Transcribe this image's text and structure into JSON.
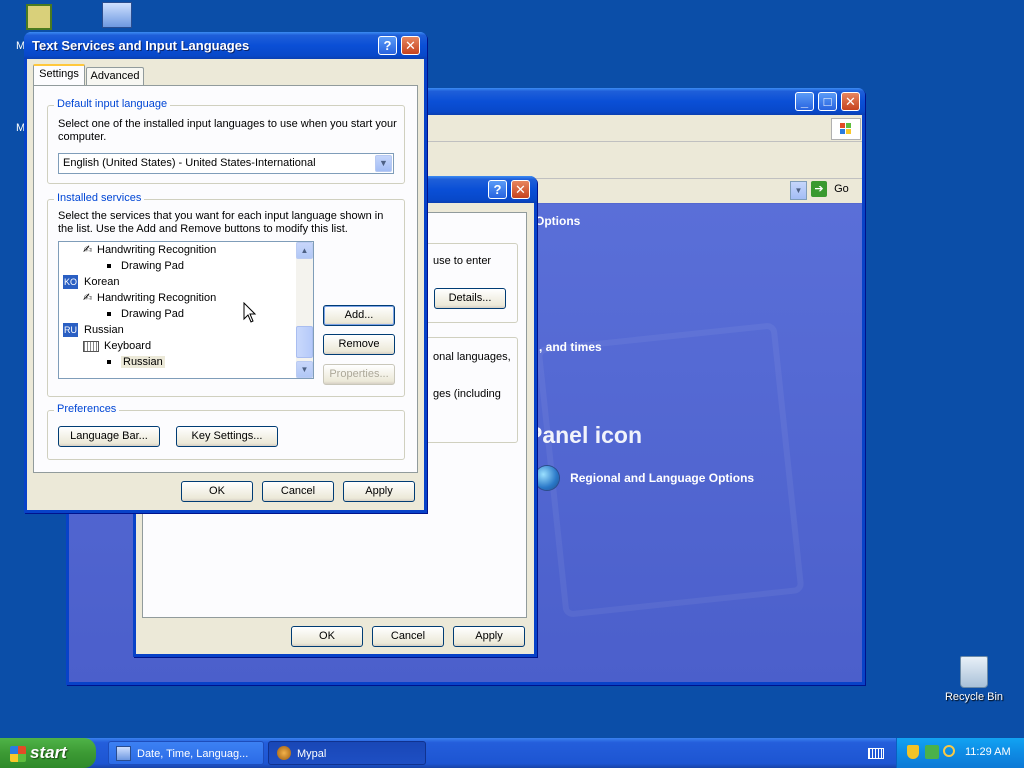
{
  "desktop": {
    "recycle_bin_label": "Recycle Bin",
    "left_icon_1_label": "M",
    "left_icon_2_label": "M"
  },
  "bg_window": {
    "address_go_label": "Go"
  },
  "cpanel": {
    "text_options": "Options",
    "text_and_times": ", and times",
    "text_panel_icon": "Panel icon",
    "link_regional": "Regional and Language Options"
  },
  "regional_dialog": {
    "text_use_to_enter": "use to enter",
    "details_button": "Details...",
    "text_onal_languages": "onal languages,",
    "text_ges_including": "ges (including",
    "ok_button": "OK",
    "cancel_button": "Cancel",
    "apply_button": "Apply"
  },
  "tsil_dialog": {
    "title": "Text Services and Input Languages",
    "tabs": [
      "Settings",
      "Advanced"
    ],
    "default_lang_group": "Default input language",
    "default_lang_desc": "Select one of the installed input languages to use when you start your computer.",
    "default_lang_value": "English (United States) - United States-International",
    "installed_group": "Installed services",
    "installed_desc": "Select the services that you want for each input language shown in the list. Use the Add and Remove buttons to modify this list.",
    "tree": [
      {
        "label": "Handwriting Recognition"
      },
      {
        "label": "Drawing Pad"
      },
      {
        "label": "Korean",
        "badge": "KO"
      },
      {
        "label": "Handwriting Recognition"
      },
      {
        "label": "Drawing Pad"
      },
      {
        "label": "Russian",
        "badge": "RU"
      },
      {
        "label": "Keyboard"
      },
      {
        "label": "Russian"
      }
    ],
    "add_button": "Add...",
    "remove_button": "Remove",
    "properties_button": "Properties...",
    "preferences_group": "Preferences",
    "language_bar_button": "Language Bar...",
    "key_settings_button": "Key Settings...",
    "ok_button": "OK",
    "cancel_button": "Cancel",
    "apply_button": "Apply"
  },
  "taskbar": {
    "start_label": "start",
    "tasks": [
      "Date, Time, Languag...",
      "Mypal"
    ],
    "clock": "11:29 AM"
  }
}
